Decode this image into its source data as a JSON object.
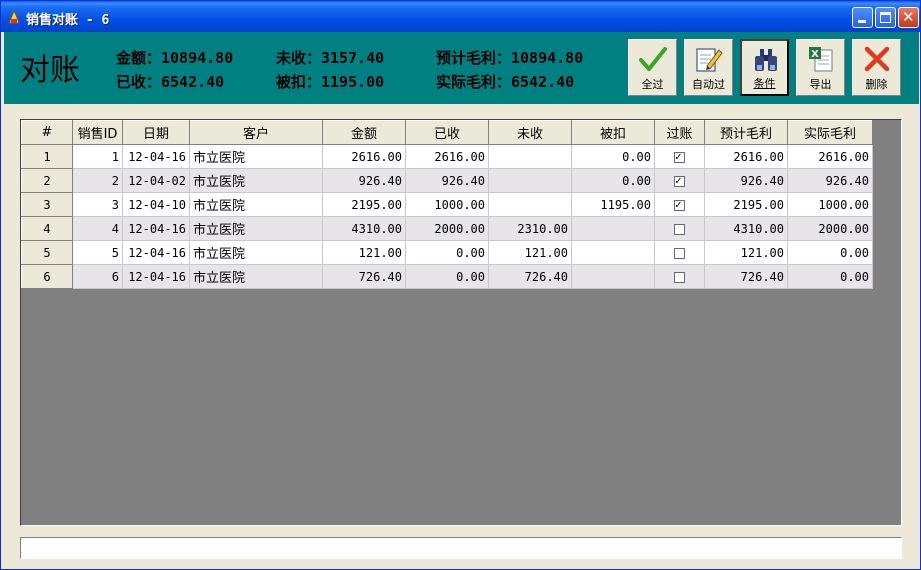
{
  "window": {
    "title": "销售对账 - 6"
  },
  "header": {
    "title": "对账",
    "stats": {
      "amount": "金额：10894.80",
      "received": "已收：6542.40",
      "unreceived": "未收：3157.40",
      "deducted": "被扣：1195.00",
      "expected_profit": "预计毛利：10894.80",
      "actual_profit": "实际毛利：6542.40"
    }
  },
  "toolbar": {
    "all_label": "全过",
    "auto_label": "自动过",
    "filter_label": "条件",
    "export_label": "导出",
    "delete_label": "删除"
  },
  "table": {
    "columns": [
      "#",
      "销售ID",
      "日期",
      "客户",
      "金额",
      "已收",
      "未收",
      "被扣",
      "过账",
      "预计毛利",
      "实际毛利"
    ],
    "rows": [
      {
        "n": "1",
        "id": "1",
        "date": "12-04-16",
        "customer": "市立医院",
        "amount": "2616.00",
        "received": "2616.00",
        "unreceived": "",
        "deducted": "0.00",
        "posted": true,
        "expected": "2616.00",
        "actual": "2616.00"
      },
      {
        "n": "2",
        "id": "2",
        "date": "12-04-02",
        "customer": "市立医院",
        "amount": "926.40",
        "received": "926.40",
        "unreceived": "",
        "deducted": "0.00",
        "posted": true,
        "expected": "926.40",
        "actual": "926.40"
      },
      {
        "n": "3",
        "id": "3",
        "date": "12-04-10",
        "customer": "市立医院",
        "amount": "2195.00",
        "received": "1000.00",
        "unreceived": "",
        "deducted": "1195.00",
        "posted": true,
        "expected": "2195.00",
        "actual": "1000.00"
      },
      {
        "n": "4",
        "id": "4",
        "date": "12-04-16",
        "customer": "市立医院",
        "amount": "4310.00",
        "received": "2000.00",
        "unreceived": "2310.00",
        "deducted": "",
        "posted": false,
        "expected": "4310.00",
        "actual": "2000.00"
      },
      {
        "n": "5",
        "id": "5",
        "date": "12-04-16",
        "customer": "市立医院",
        "amount": "121.00",
        "received": "0.00",
        "unreceived": "121.00",
        "deducted": "",
        "posted": false,
        "expected": "121.00",
        "actual": "0.00"
      },
      {
        "n": "6",
        "id": "6",
        "date": "12-04-16",
        "customer": "市立医院",
        "amount": "726.40",
        "received": "0.00",
        "unreceived": "726.40",
        "deducted": "",
        "posted": false,
        "expected": "726.40",
        "actual": "0.00"
      }
    ]
  },
  "statusbar": {
    "text": ""
  }
}
